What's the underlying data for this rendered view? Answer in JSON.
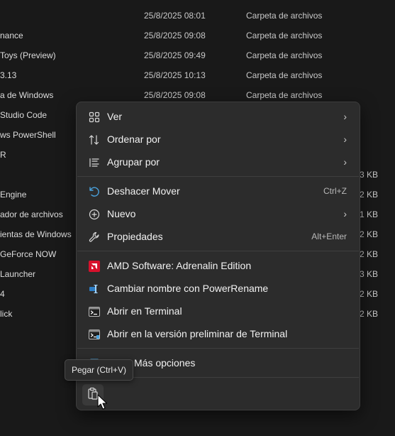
{
  "files": [
    {
      "name": "",
      "date": "25/8/2025 08:01",
      "type": "Carpeta de archivos",
      "size": ""
    },
    {
      "name": "nance",
      "date": "25/8/2025 09:08",
      "type": "Carpeta de archivos",
      "size": ""
    },
    {
      "name": "Toys (Preview)",
      "date": "25/8/2025 09:49",
      "type": "Carpeta de archivos",
      "size": ""
    },
    {
      "name": "3.13",
      "date": "25/8/2025 10:13",
      "type": "Carpeta de archivos",
      "size": ""
    },
    {
      "name": "a de Windows",
      "date": "25/8/2025 09:08",
      "type": "Carpeta de archivos",
      "size": ""
    },
    {
      "name": "Studio Code",
      "date": "",
      "type": "",
      "size": ""
    },
    {
      "name": "ws PowerShell",
      "date": "",
      "type": "",
      "size": ""
    },
    {
      "name": "R",
      "date": "",
      "type": "",
      "size": ""
    },
    {
      "name": "",
      "date": "",
      "type": "",
      "size": "3 KB"
    },
    {
      "name": "Engine",
      "date": "",
      "type": "",
      "size": "2 KB"
    },
    {
      "name": "ador de archivos",
      "date": "",
      "type": "",
      "size": "1 KB"
    },
    {
      "name": "ientas de Windows",
      "date": "",
      "type": "",
      "size": "2 KB"
    },
    {
      "name": "GeForce NOW",
      "date": "",
      "type": "",
      "size": "2 KB"
    },
    {
      "name": "Launcher",
      "date": "",
      "type": "",
      "size": "3 KB"
    },
    {
      "name": "4",
      "date": "",
      "type": "",
      "size": "2 KB"
    },
    {
      "name": "lick",
      "date": "",
      "type": "",
      "size": "2 KB"
    }
  ],
  "context_menu": {
    "items": [
      {
        "label": "Ver",
        "shortcut": "",
        "submenu": true,
        "icon": "grid-view-icon"
      },
      {
        "label": "Ordenar por",
        "shortcut": "",
        "submenu": true,
        "icon": "sort-icon"
      },
      {
        "label": "Agrupar por",
        "shortcut": "",
        "submenu": true,
        "icon": "group-list-icon"
      },
      {
        "label": "Deshacer Mover",
        "shortcut": "Ctrl+Z",
        "submenu": false,
        "icon": "undo-icon"
      },
      {
        "label": "Nuevo",
        "shortcut": "",
        "submenu": true,
        "icon": "new-plus-icon"
      },
      {
        "label": "Propiedades",
        "shortcut": "Alt+Enter",
        "submenu": false,
        "icon": "wrench-icon"
      },
      {
        "label": "AMD Software: Adrenalin Edition",
        "shortcut": "",
        "submenu": false,
        "icon": "amd-icon"
      },
      {
        "label": "Cambiar nombre con PowerRename",
        "shortcut": "",
        "submenu": false,
        "icon": "powerrename-icon"
      },
      {
        "label": "Abrir en Terminal",
        "shortcut": "",
        "submenu": false,
        "icon": "terminal-icon"
      },
      {
        "label": "Abrir en la versión preliminar de Terminal",
        "shortcut": "",
        "submenu": false,
        "icon": "terminal-preview-icon"
      },
      {
        "label": "rar Más opciones",
        "shortcut": "",
        "submenu": false,
        "icon": "more-options-icon"
      }
    ],
    "chevron": "›",
    "paste_button_icon": "paste-icon"
  },
  "tooltip": {
    "text": "Pegar (Ctrl+V)"
  },
  "colors": {
    "amd_red": "#d7112c",
    "accent_blue": "#4aa3df"
  }
}
